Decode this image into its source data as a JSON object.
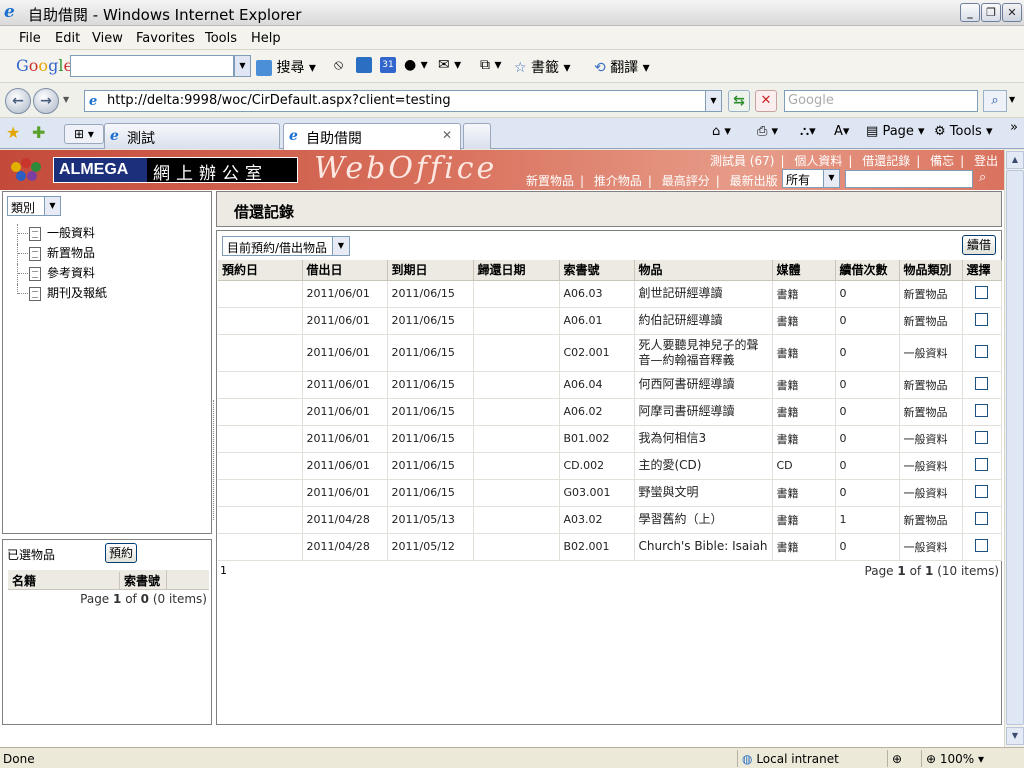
{
  "window": {
    "title": "自助借閱 - Windows Internet Explorer"
  },
  "menu": [
    "File",
    "Edit",
    "View",
    "Favorites",
    "Tools",
    "Help"
  ],
  "google_toolbar": {
    "logo": "Google",
    "search_label": "搜尋",
    "bookmarks_label": "書籤",
    "translate_label": "翻譯",
    "calendar_label": "31"
  },
  "address": {
    "url": "http://delta:9998/woc/CirDefault.aspx?client=testing",
    "search_placeholder": "Google"
  },
  "tabs": [
    {
      "label": "測試"
    },
    {
      "label": "自助借閱",
      "active": true
    }
  ],
  "command_bar": {
    "page_label": "Page",
    "tools_label": "Tools"
  },
  "site_header": {
    "brand": "ALMEGA",
    "brand_zh": "網上辦公室",
    "product": "WebOffice",
    "top_links": [
      "測試員 (67)",
      "個人資料",
      "借還記錄",
      "備忘",
      "登出"
    ],
    "nav_links": [
      "新置物品",
      "推介物品",
      "最高評分",
      "最新出版"
    ],
    "scope_select": "所有"
  },
  "sidebar": {
    "category_select": "類別",
    "categories": [
      "一般資料",
      "新置物品",
      "參考資料",
      "期刊及報紙"
    ]
  },
  "selected_panel": {
    "label": "已選物品",
    "reserve_button": "預約",
    "columns": [
      "名籍",
      "索書號"
    ],
    "pager": {
      "prefix": "Page",
      "page": "1",
      "of": "of",
      "total": "0",
      "items": "(0 items)"
    }
  },
  "main": {
    "title": "借還記錄",
    "filter_select": "目前預約/借出物品",
    "renew_button": "續借",
    "columns": [
      "預約日",
      "借出日",
      "到期日",
      "歸還日期",
      "索書號",
      "物品",
      "媒體",
      "續借次數",
      "物品類別",
      "選擇"
    ],
    "rows": [
      {
        "reserve": "",
        "out": "2011/06/01",
        "due": "2011/06/15",
        "returned": "",
        "callno": "A06.03",
        "item": "創世記研經導讀",
        "media": "書籍",
        "renewals": "0",
        "category": "新置物品"
      },
      {
        "reserve": "",
        "out": "2011/06/01",
        "due": "2011/06/15",
        "returned": "",
        "callno": "A06.01",
        "item": "約伯記研經導讀",
        "media": "書籍",
        "renewals": "0",
        "category": "新置物品"
      },
      {
        "reserve": "",
        "out": "2011/06/01",
        "due": "2011/06/15",
        "returned": "",
        "callno": "C02.001",
        "item": "死人要聽見神兒子的聲音—約翰福音釋義",
        "media": "書籍",
        "renewals": "0",
        "category": "一般資料"
      },
      {
        "reserve": "",
        "out": "2011/06/01",
        "due": "2011/06/15",
        "returned": "",
        "callno": "A06.04",
        "item": "何西阿書研經導讀",
        "media": "書籍",
        "renewals": "0",
        "category": "新置物品"
      },
      {
        "reserve": "",
        "out": "2011/06/01",
        "due": "2011/06/15",
        "returned": "",
        "callno": "A06.02",
        "item": "阿摩司書研經導讀",
        "media": "書籍",
        "renewals": "0",
        "category": "新置物品"
      },
      {
        "reserve": "",
        "out": "2011/06/01",
        "due": "2011/06/15",
        "returned": "",
        "callno": "B01.002",
        "item": "我為何相信3",
        "media": "書籍",
        "renewals": "0",
        "category": "一般資料"
      },
      {
        "reserve": "",
        "out": "2011/06/01",
        "due": "2011/06/15",
        "returned": "",
        "callno": "CD.002",
        "item": "主的愛(CD)",
        "media": "CD",
        "renewals": "0",
        "category": "一般資料"
      },
      {
        "reserve": "",
        "out": "2011/06/01",
        "due": "2011/06/15",
        "returned": "",
        "callno": "G03.001",
        "item": "野蠻與文明",
        "media": "書籍",
        "renewals": "0",
        "category": "一般資料"
      },
      {
        "reserve": "",
        "out": "2011/04/28",
        "due": "2011/05/13",
        "returned": "",
        "callno": "A03.02",
        "item": "學習舊約（上）",
        "media": "書籍",
        "renewals": "1",
        "category": "新置物品"
      },
      {
        "reserve": "",
        "out": "2011/04/28",
        "due": "2011/05/12",
        "returned": "",
        "callno": "B02.001",
        "item": "Church's Bible: Isaiah",
        "media": "書籍",
        "renewals": "0",
        "category": "一般資料"
      }
    ],
    "page_link": "1",
    "pager": {
      "prefix": "Page",
      "page": "1",
      "of": "of",
      "total": "1",
      "items": "(10 items)"
    }
  },
  "status": {
    "text": "Done",
    "zone": "Local intranet",
    "zoom": "100%"
  },
  "colors": {
    "header_red": "#c34a3a",
    "brand_blue": "#1c2f7a",
    "panel_gray": "#eceae2"
  }
}
